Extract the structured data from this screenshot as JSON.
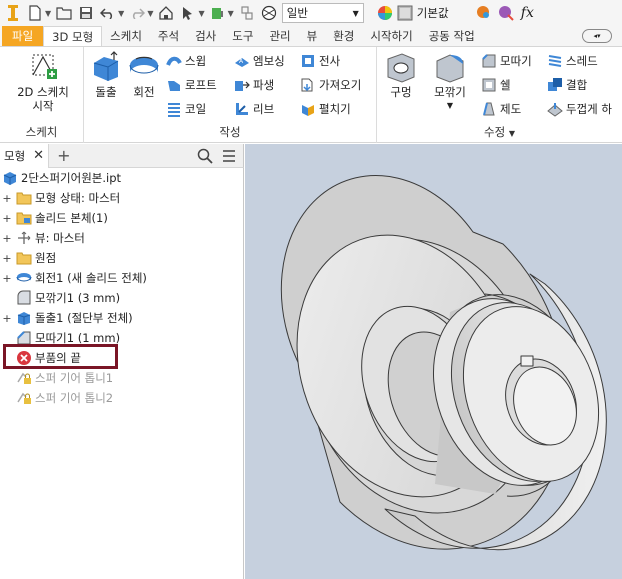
{
  "qat": {
    "appearance_value": "일반",
    "material_value": "기본값",
    "fx_label": "fx"
  },
  "tabs": [
    {
      "label": "파일"
    },
    {
      "label": "3D 모형"
    },
    {
      "label": "스케치"
    },
    {
      "label": "주석"
    },
    {
      "label": "검사"
    },
    {
      "label": "도구"
    },
    {
      "label": "관리"
    },
    {
      "label": "뷰"
    },
    {
      "label": "환경"
    },
    {
      "label": "시작하기"
    },
    {
      "label": "공동 작업"
    }
  ],
  "ribbon": {
    "sketch_panel": {
      "title": "스케치",
      "start_sketch": "2D 스케치",
      "start_sketch_2": "시작"
    },
    "create_panel": {
      "title": "작성",
      "extrude": "돌출",
      "revolve": "회전",
      "sweep": "스윕",
      "loft": "로프트",
      "coil": "코일",
      "emboss": "엠보싱",
      "derive": "파생",
      "rib": "리브",
      "decal": "전사",
      "import": "가져오기",
      "unfold": "펼치기"
    },
    "modify_panel": {
      "title": "수정",
      "hole": "구멍",
      "fillet": "모깎기",
      "chamfer": "모따기",
      "shell": "쉘",
      "draft": "제도",
      "thread": "스레드",
      "combine": "결합",
      "thicken": "두껍게 하"
    }
  },
  "browser": {
    "tab_label": "모형",
    "items": [
      {
        "label": "2단스퍼기어원본.ipt"
      },
      {
        "label": "모형 상태: 마스터"
      },
      {
        "label": "솔리드 본체(1)"
      },
      {
        "label": "뷰: 마스터"
      },
      {
        "label": "원점"
      },
      {
        "label": "회전1 (새 솔리드 전체)"
      },
      {
        "label": "모깎기1 (3 mm)"
      },
      {
        "label": "돌출1 (절단부 전체)"
      },
      {
        "label": "모따기1 (1 mm)"
      },
      {
        "label": "부품의 끝"
      },
      {
        "label": "스퍼 기어 톱니1"
      },
      {
        "label": "스퍼 기어 톱니2"
      }
    ]
  },
  "colors": {
    "file_tab": "#f5a623",
    "viewport_bg": "#c6d0de",
    "highlight": "#7a1526",
    "folder": "#f2c65a",
    "part_blue": "#3f87d6"
  }
}
